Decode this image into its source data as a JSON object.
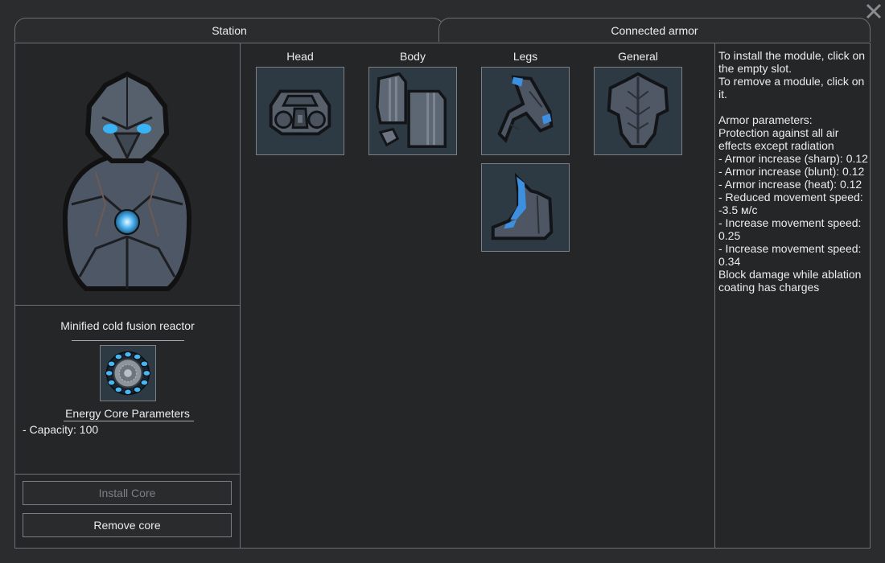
{
  "tabs": {
    "station": "Station",
    "connected_armor": "Connected armor"
  },
  "core": {
    "name": "Minified cold fusion reactor",
    "params_title": "Energy Core Parameters",
    "capacity_text": "- Capacity: 100"
  },
  "buttons": {
    "install": "Install Core",
    "remove": "Remove core"
  },
  "slots": {
    "head": "Head",
    "body": "Body",
    "legs": "Legs",
    "general": "General"
  },
  "info": {
    "install_hint": "To install the module, click on the empty slot.",
    "remove_hint": "To remove a module, click on it.",
    "params_title": "Armor parameters:",
    "lines": [
      "Protection against all air effects except radiation",
      "- Armor increase (sharp): 0.12",
      "- Armor increase (blunt): 0.12",
      "- Armor increase (heat): 0.12",
      "- Reduced movement speed: -3.5 м/с",
      "- Increase movement speed: 0.25",
      "- Increase movement speed: 0.34",
      "Block damage while ablation coating has charges"
    ]
  },
  "colors": {
    "window_bg": "#2b2c2e",
    "panel_bg": "#252628",
    "border": "#6e7073",
    "slot_bg": "#2d3a44",
    "accent_blue": "#3aa0e8"
  },
  "icons": {
    "close": "close-x-icon",
    "armor_preview": "power-armor-preview-icon",
    "core": "arc-reactor-core-icon",
    "head": "helmet-module-icon",
    "body": "body-plates-module-icon",
    "legs1": "leg-armor-module-icon",
    "legs2": "boot-armor-module-icon",
    "general": "armor-frame-module-icon"
  }
}
